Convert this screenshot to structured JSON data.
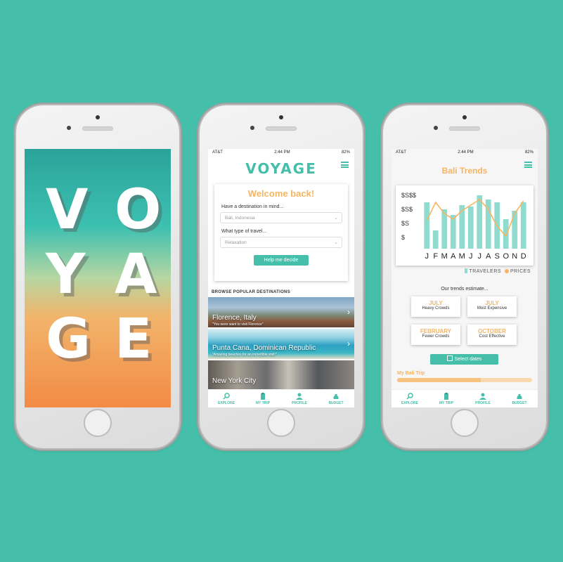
{
  "splash": {
    "letters": [
      "V",
      "O",
      "Y",
      "A",
      "G",
      "E"
    ]
  },
  "status": {
    "carrier": "AT&T",
    "time": "2:44 PM",
    "battery": "82%"
  },
  "home": {
    "logo": "VOYAGE",
    "welcome": "Welcome back!",
    "dest_label": "Have a destination in mind...",
    "dest_value": "Bali, Indonesia",
    "travel_label": "What type of travel...",
    "travel_value": "Relaxation",
    "help_button": "Help me decide",
    "browse_heading": "BROWSE POPULAR DESTINATIONS",
    "destinations": [
      {
        "name": "Florence, Italy",
        "sub": "\"You were want to visit Florence\""
      },
      {
        "name": "Punta Cana, Dominican Republic",
        "sub": "\"Amazing beaches for an incredible visit!\""
      },
      {
        "name": "New York City",
        "sub": ""
      }
    ]
  },
  "tabs": [
    {
      "label": "EXPLORE",
      "icon": "search-icon"
    },
    {
      "label": "MY TRIP",
      "icon": "clipboard-icon"
    },
    {
      "label": "PROFILE",
      "icon": "person-icon"
    },
    {
      "label": "BUDGET",
      "icon": "money-bag-icon"
    }
  ],
  "trends": {
    "title": "Bali Trends",
    "estimate_label": "Our trends estimate...",
    "estimates": [
      {
        "month": "JULY",
        "desc": "Heavy Crowds"
      },
      {
        "month": "JULY",
        "desc": "Most Expensive"
      },
      {
        "month": "FEBRUARY",
        "desc": "Fewer Crowds"
      },
      {
        "month": "OCTOBER",
        "desc": "Cost Effective"
      }
    ],
    "select_dates": "Select dates",
    "trip_label": "My Bali Trip",
    "trip_progress": 0.62
  },
  "colors": {
    "teal": "#45bfa9",
    "orange": "#f6b562",
    "bar": "#8fdccf"
  },
  "chart_data": {
    "type": "bar",
    "categories": [
      "J",
      "F",
      "M",
      "A",
      "M",
      "J",
      "J",
      "A",
      "S",
      "O",
      "N",
      "D"
    ],
    "y_ticks": [
      "$",
      "$S",
      "$S$",
      "$S$$"
    ],
    "series": [
      {
        "name": "TRAVELERS",
        "type": "bar",
        "values": [
          3.3,
          1.3,
          2.8,
          2.4,
          3.1,
          3.0,
          3.8,
          3.5,
          3.3,
          2.1,
          2.7,
          3.3
        ]
      },
      {
        "name": "PRICES",
        "type": "line",
        "values": [
          2.0,
          3.3,
          2.5,
          2.1,
          2.7,
          3.1,
          3.5,
          2.8,
          1.6,
          0.9,
          2.5,
          3.4
        ]
      }
    ],
    "ylim": [
      0,
      4
    ]
  }
}
